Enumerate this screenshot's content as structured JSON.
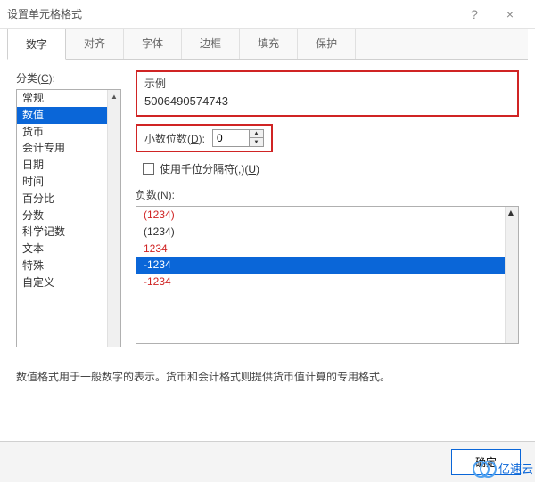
{
  "window": {
    "title": "设置单元格格式",
    "help": "?",
    "close": "×"
  },
  "tabs": [
    {
      "label": "数字",
      "active": true
    },
    {
      "label": "对齐"
    },
    {
      "label": "字体"
    },
    {
      "label": "边框"
    },
    {
      "label": "填充"
    },
    {
      "label": "保护"
    }
  ],
  "category": {
    "label": "分类(C):",
    "items": [
      {
        "label": "常规"
      },
      {
        "label": "数值",
        "selected": true
      },
      {
        "label": "货币"
      },
      {
        "label": "会计专用"
      },
      {
        "label": "日期"
      },
      {
        "label": "时间"
      },
      {
        "label": "百分比"
      },
      {
        "label": "分数"
      },
      {
        "label": "科学记数"
      },
      {
        "label": "文本"
      },
      {
        "label": "特殊"
      },
      {
        "label": "自定义"
      }
    ]
  },
  "example": {
    "label": "示例",
    "value": "5006490574743"
  },
  "decimals": {
    "label": "小数位数(D):",
    "value": "0"
  },
  "thousands": {
    "label": "使用千位分隔符(,)(U)"
  },
  "negative": {
    "label": "负数(N):",
    "items": [
      {
        "text": "(1234)",
        "style": "red"
      },
      {
        "text": "(1234)",
        "style": "black"
      },
      {
        "text": "1234",
        "style": "red"
      },
      {
        "text": "-1234",
        "style": "selected"
      },
      {
        "text": "-1234",
        "style": "red"
      }
    ]
  },
  "description": "数值格式用于一般数字的表示。货币和会计格式则提供货币值计算的专用格式。",
  "buttons": {
    "ok": "确定"
  },
  "watermark": "亿速云"
}
